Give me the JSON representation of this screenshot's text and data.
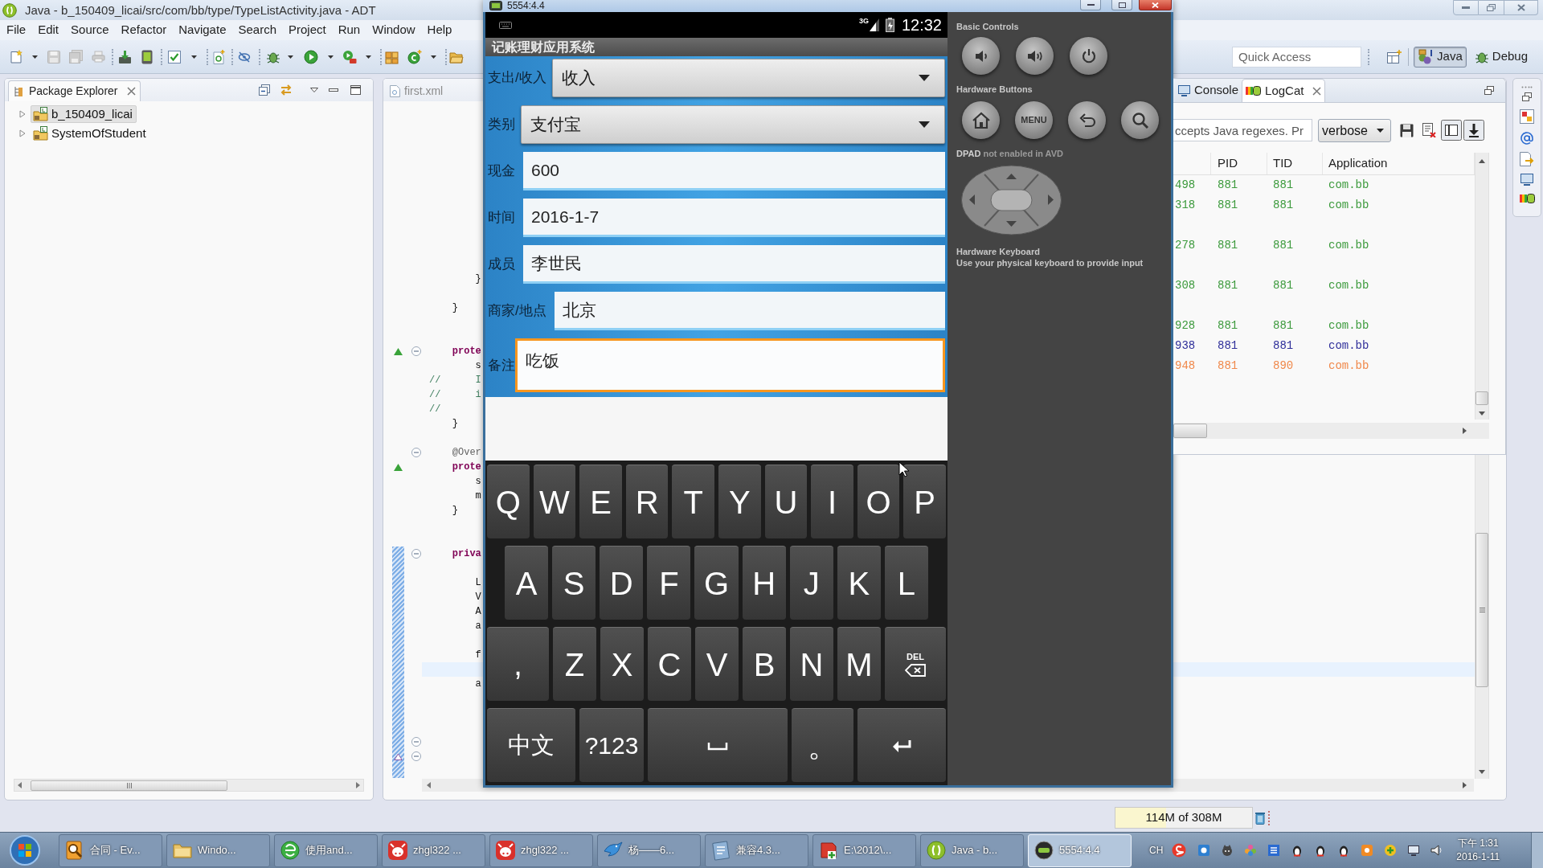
{
  "ide": {
    "title": "Java - b_150409_licai/src/com/bb/type/TypeListActivity.java - ADT",
    "menu": [
      "File",
      "Edit",
      "Source",
      "Refactor",
      "Navigate",
      "Search",
      "Project",
      "Run",
      "Window",
      "Help"
    ],
    "quick_access": {
      "placeholder": "Quick Access"
    },
    "perspectives": [
      {
        "label": "Java",
        "selected": true
      },
      {
        "label": "Debug",
        "selected": false
      }
    ],
    "package_explorer": {
      "title": "Package Explorer",
      "items": [
        {
          "label": "b_150409_licai",
          "selected": true,
          "expanded": false
        },
        {
          "label": "SystemOfStudent",
          "selected": false,
          "expanded": false
        }
      ]
    },
    "editor": {
      "tab": "first.xml",
      "hunks": [
        {
          "changed": false,
          "lines": [
            {
              "text": "\t\t}",
              "kind": "plain",
              "foldable": false,
              "current": false
            },
            {
              "foldable": false,
              "current": false
            },
            {
              "text": "\t}",
              "kind": "plain",
              "foldable": false,
              "current": false
            },
            {
              "foldable": false,
              "current": false
            },
            {
              "foldable": false,
              "current": false
            },
            {
              "text": "\tprote",
              "kind": "keyword",
              "marker": {
                "kind": "overrides"
              },
              "foldable": true,
              "current": false
            },
            {
              "text": "\t\ts",
              "kind": "plain",
              "foldable": false,
              "current": false
            },
            {
              "text": "//\t\tI",
              "kind": "comment",
              "foldable": false,
              "current": false
            },
            {
              "text": "//\t\ti",
              "kind": "comment",
              "foldable": false,
              "current": false
            },
            {
              "text": "//",
              "kind": "comment",
              "foldable": false,
              "current": false
            },
            {
              "text": "\t}",
              "kind": "plain",
              "foldable": false,
              "current": false
            },
            {
              "foldable": false,
              "current": false
            },
            {
              "text": "\t@Over",
              "kind": "annotation",
              "foldable": true,
              "current": false
            },
            {
              "text": "\tprote",
              "kind": "keyword",
              "marker": {
                "kind": "overrides"
              },
              "foldable": false,
              "current": false
            },
            {
              "text": "\t\ts",
              "kind": "plain",
              "foldable": false,
              "current": false
            },
            {
              "text": "\t\tm",
              "kind": "plain",
              "foldable": false,
              "current": false
            },
            {
              "text": "\t}",
              "kind": "plain",
              "foldable": false,
              "current": false
            },
            {
              "foldable": false,
              "current": false
            },
            {
              "foldable": false,
              "current": false
            }
          ]
        },
        {
          "changed": true,
          "lines": [
            {
              "text": "\tpriva",
              "kind": "keyword",
              "foldable": true,
              "current": false
            },
            {
              "foldable": false,
              "current": false
            },
            {
              "text": "\t\tL",
              "kind": "plain",
              "foldable": false,
              "current": false
            },
            {
              "text": "\t\tV",
              "kind": "plain",
              "foldable": false,
              "current": false
            },
            {
              "text": "\t\tA",
              "kind": "plain",
              "foldable": false,
              "current": false
            },
            {
              "text": "\t\ta",
              "kind": "plain",
              "foldable": false,
              "current": false
            },
            {
              "foldable": false,
              "current": false
            },
            {
              "text": "\t\tf",
              "kind": "plain",
              "foldable": false,
              "current": false
            },
            {
              "foldable": false,
              "current": true
            },
            {
              "text": "\t\ta",
              "kind": "plain",
              "foldable": false,
              "current": false
            },
            {
              "foldable": false,
              "current": false
            },
            {
              "foldable": false,
              "current": false
            },
            {
              "foldable": false,
              "current": false
            },
            {
              "foldable": true,
              "current": false
            },
            {
              "marker": {
                "kind": "implements"
              },
              "foldable": true,
              "current": false
            },
            {
              "foldable": false,
              "current": false
            }
          ]
        }
      ]
    },
    "logcat": {
      "tabs": [
        {
          "label": "Console",
          "selected": false
        },
        {
          "label": "LogCat",
          "selected": true
        }
      ],
      "filter": {
        "placeholder": "ccepts Java regexes. Pr"
      },
      "log_level": {
        "value": "verbose"
      },
      "columns": [
        "",
        "PID",
        "TID",
        "Application"
      ],
      "rows": [
        {
          "cells": [
            "498",
            "881",
            "881",
            "com.bb"
          ],
          "color": "#3c9a3c",
          "multiline": false
        },
        {
          "cells": [
            "318",
            "881",
            "881",
            "com.bb"
          ],
          "color": "#3c9a3c",
          "multiline": true
        },
        {
          "cells": [
            "278",
            "881",
            "881",
            "com.bb"
          ],
          "color": "#3c9a3c",
          "multiline": true
        },
        {
          "cells": [
            "308",
            "881",
            "881",
            "com.bb"
          ],
          "color": "#3c9a3c",
          "multiline": true
        },
        {
          "cells": [
            "928",
            "881",
            "881",
            "com.bb"
          ],
          "color": "#3c9a3c",
          "multiline": false
        },
        {
          "cells": [
            "938",
            "881",
            "881",
            "com.bb"
          ],
          "color": "#2e2e9a",
          "multiline": false
        },
        {
          "cells": [
            "948",
            "881",
            "890",
            "com.bb"
          ],
          "color": "#f0884a",
          "multiline": false
        }
      ]
    },
    "heap": {
      "text": "114M of 308M",
      "level": 0.37
    }
  },
  "emulator": {
    "title": "5554:4.4",
    "status_bar": {
      "network": "3G",
      "time": "12:32"
    },
    "app_title": "记账理财应用系统",
    "form": [
      {
        "label": "支出/收入",
        "kind": "spinner",
        "value": "收入",
        "focused": false
      },
      {
        "label": "类别",
        "kind": "spinner",
        "value": "支付宝",
        "focused": false
      },
      {
        "label": "现金",
        "kind": "text",
        "value": "600",
        "focused": false
      },
      {
        "label": "时间",
        "kind": "text",
        "value": "2016-1-7",
        "focused": false
      },
      {
        "label": "成员",
        "kind": "text",
        "value": "李世民",
        "focused": false
      },
      {
        "label": "商家/地点",
        "kind": "text",
        "value": "北京",
        "focused": false
      },
      {
        "label": "备注",
        "kind": "multiline",
        "value": "吃饭",
        "focused": true
      }
    ],
    "keyboard": {
      "key_rows": [
        {
          "keys": [
            {
              "label": "Q",
              "kind": "letter"
            },
            {
              "label": "W",
              "kind": "letter"
            },
            {
              "label": "E",
              "kind": "letter"
            },
            {
              "label": "R",
              "kind": "letter"
            },
            {
              "label": "T",
              "kind": "letter"
            },
            {
              "label": "Y",
              "kind": "letter"
            },
            {
              "label": "U",
              "kind": "letter"
            },
            {
              "label": "I",
              "kind": "letter"
            },
            {
              "label": "O",
              "kind": "letter"
            },
            {
              "label": "P",
              "kind": "letter"
            }
          ]
        },
        {
          "keys": [
            {
              "label": "A",
              "kind": "letter"
            },
            {
              "label": "S",
              "kind": "letter"
            },
            {
              "label": "D",
              "kind": "letter"
            },
            {
              "label": "F",
              "kind": "letter"
            },
            {
              "label": "G",
              "kind": "letter"
            },
            {
              "label": "H",
              "kind": "letter"
            },
            {
              "label": "J",
              "kind": "letter"
            },
            {
              "label": "K",
              "kind": "letter"
            },
            {
              "label": "L",
              "kind": "letter"
            }
          ]
        },
        {
          "keys": [
            {
              "label": ",",
              "kind": "punctuation"
            },
            {
              "label": "Z",
              "kind": "letter"
            },
            {
              "label": "X",
              "kind": "letter"
            },
            {
              "label": "C",
              "kind": "letter"
            },
            {
              "label": "V",
              "kind": "letter"
            },
            {
              "label": "B",
              "kind": "letter"
            },
            {
              "label": "N",
              "kind": "letter"
            },
            {
              "label": "M",
              "kind": "letter"
            },
            {
              "label": "DEL",
              "kind": "delete"
            }
          ]
        },
        {
          "keys": [
            {
              "label": "中文",
              "kind": "language"
            },
            {
              "label": "?123",
              "kind": "symbols"
            },
            {
              "kind": "space"
            },
            {
              "label": "。",
              "kind": "punctuation"
            },
            {
              "kind": "enter"
            }
          ]
        }
      ]
    },
    "controls": {
      "basic_title": "Basic Controls",
      "hardware_title": "Hardware Buttons",
      "menu_label": "MENU",
      "dpad_note": "**DPAD** not enabled in AVD",
      "keyboard_title": "Hardware Keyboard",
      "keyboard_note": "Use your physical keyboard to provide input"
    }
  },
  "taskbar": {
    "tasks": [
      {
        "label": "合同 - Ev...",
        "kind": "viewer",
        "selected": false
      },
      {
        "label": "Windo...",
        "kind": "folder",
        "selected": false
      },
      {
        "label": "使用and...",
        "kind": "browser",
        "selected": false
      },
      {
        "label": "zhgl322 ...",
        "kind": "cow",
        "selected": false
      },
      {
        "label": "zhgl322 ...",
        "kind": "cow",
        "selected": false
      },
      {
        "label": "杨——6...",
        "kind": "bird",
        "selected": false
      },
      {
        "label": "兼容4.3...",
        "kind": "notebook",
        "selected": false
      },
      {
        "label": "E:\\2012\\...",
        "kind": "installer",
        "selected": false
      },
      {
        "label": "Java - b...",
        "kind": "ide",
        "selected": false
      },
      {
        "label": "5554:4.4",
        "kind": "emulator",
        "selected": true
      }
    ],
    "tray": {
      "language": "CH",
      "time": "下午 1:31",
      "date": "2016-1-11"
    }
  }
}
